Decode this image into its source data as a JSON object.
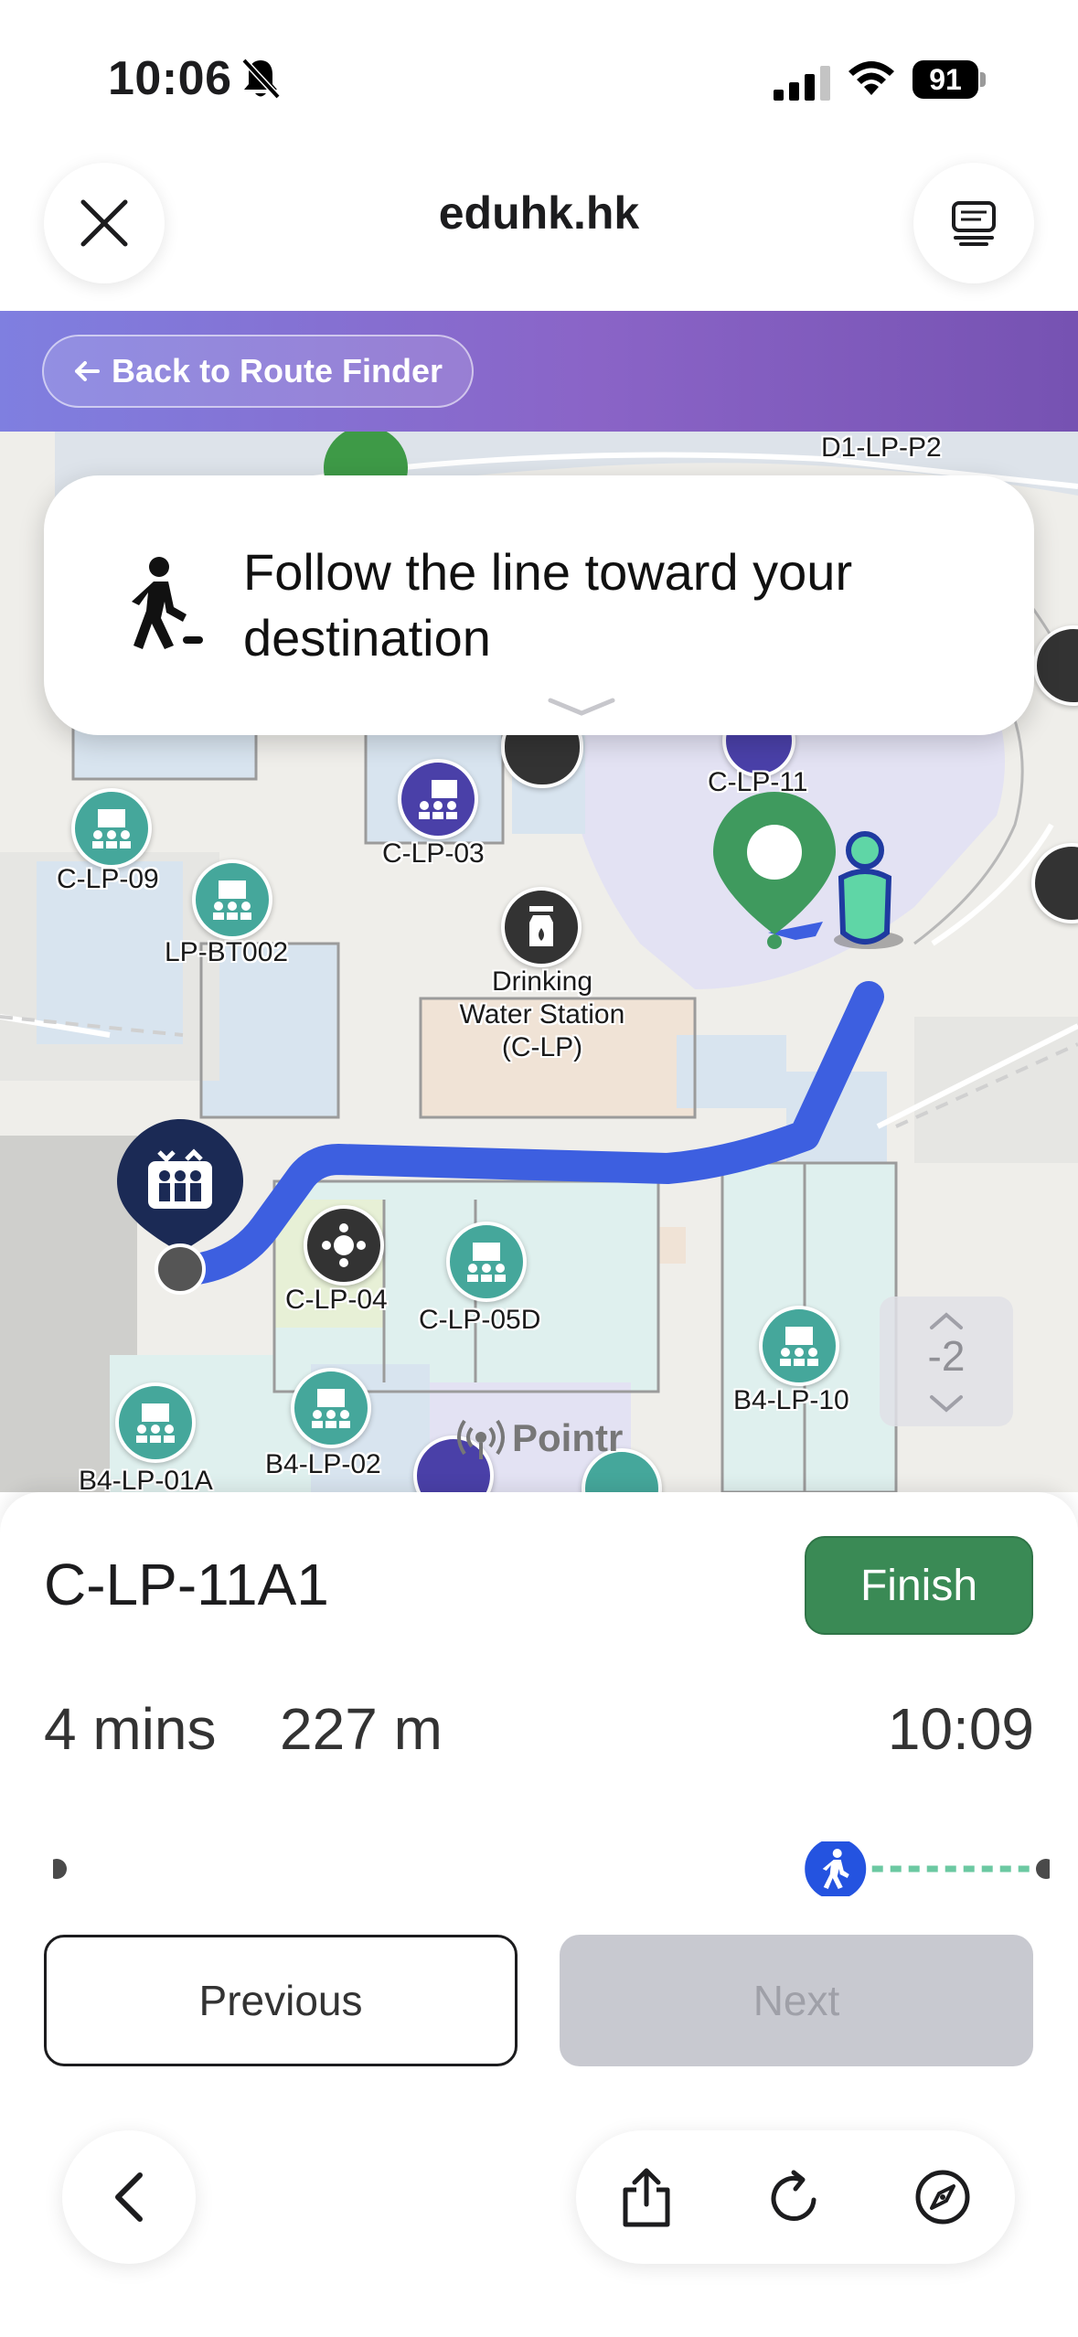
{
  "status_bar": {
    "time": "10:06",
    "battery": "91"
  },
  "browser": {
    "title": "eduhk.hk"
  },
  "banner": {
    "back_label": "Back to Route Finder"
  },
  "map": {
    "labels": {
      "d1_lp_p2": "D1-LP-P2",
      "c_lp_11": "C-LP-11",
      "c_lp_09": "C-LP-09",
      "lp_bt002": "LP-BT002",
      "c_lp_03": "C-LP-03",
      "drinking_water": "Drinking\nWater Station\n(C-LP)",
      "c_lp_04": "C-LP-04",
      "c_lp_05d": "C-LP-05D",
      "b4_lp_10": "B4-LP-10",
      "b4_lp_02": "B4-LP-02",
      "b4_lp_01a": "B4-LP-01A"
    },
    "floor_level": "-2",
    "logo": "Pointr",
    "colors": {
      "route": "#3d5fe0",
      "teal_poi": "#45a79b",
      "indigo_poi": "#4a40a8",
      "destination_pin": "#3f9a5e",
      "user_marker": "#5fd6a6"
    }
  },
  "instruction": {
    "text": "Follow the line toward your destination",
    "icon": "walking-person-icon"
  },
  "sheet": {
    "destination": "C-LP-11A1",
    "finish_label": "Finish",
    "duration": "4 mins",
    "distance": "227 m",
    "arrival_time": "10:09",
    "progress": 0.79,
    "previous_label": "Previous",
    "next_label": "Next"
  },
  "toolbar": {
    "icons": [
      "back-chevron-icon",
      "share-icon",
      "reload-icon",
      "compass-icon"
    ]
  }
}
